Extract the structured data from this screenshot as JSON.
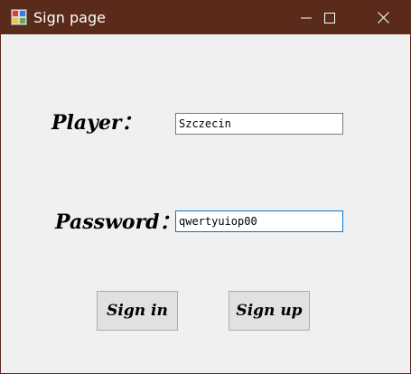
{
  "window": {
    "title": "Sign page"
  },
  "form": {
    "player_label": "Player：",
    "player_value": "Szczecin",
    "password_label": "Password：",
    "password_value": "qwertyuiop00"
  },
  "buttons": {
    "sign_in": "Sign in",
    "sign_up": "Sign up"
  },
  "colors": {
    "titlebar": "#5a2a1a",
    "client_bg": "#f0f0f0",
    "focus_border": "#0078d7"
  },
  "icons": {
    "app": "app-window-icon",
    "minimize": "minimize-icon",
    "maximize": "maximize-icon",
    "close": "close-icon"
  }
}
